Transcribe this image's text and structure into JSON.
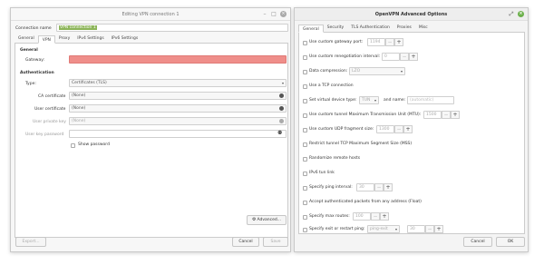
{
  "left": {
    "title": "Editing VPN connection 1",
    "connection_name_label": "Connection name",
    "connection_name_value": "VPN connection 1",
    "tabs": [
      "General",
      "VPN",
      "Proxy",
      "IPv4 Settings",
      "IPv6 Settings"
    ],
    "general_heading": "General",
    "gateway_label": "Gateway:",
    "auth_heading": "Authentication",
    "type_label": "Type:",
    "type_value": "Certificates (TLS)",
    "ca_label": "CA certificate",
    "ca_value": "(None)",
    "user_cert_label": "User certificate",
    "user_cert_value": "(None)",
    "private_key_label": "User private key",
    "private_key_value": "(None)",
    "key_password_label": "User key password",
    "show_password_label": "Show password",
    "advanced_button": "Advanced...",
    "export_button": "Export...",
    "cancel_button": "Cancel",
    "save_button": "Save"
  },
  "right": {
    "title": "OpenVPN Advanced Options",
    "tabs": [
      "General",
      "Security",
      "TLS Authentication",
      "Proxies",
      "Misc"
    ],
    "options": {
      "gateway_port_label": "Use custom gateway port:",
      "gateway_port_value": "1194",
      "reneg_label": "Use custom renegotiation interval:",
      "reneg_value": "0",
      "compression_label": "Data compression:",
      "compression_value": "LZO",
      "tcp_label": "Use a TCP connection",
      "vdev_label": "Set virtual device type:",
      "vdev_value": "TUN",
      "vdev_name_label": "and name:",
      "vdev_name_placeholder": "(automatic)",
      "mtu_label": "Use custom tunnel Maximum Transmission Unit (MTU):",
      "mtu_value": "1500",
      "udp_frag_label": "Use custom UDP fragment size:",
      "udp_frag_value": "1300",
      "mss_label": "Restrict tunnel TCP Maximum Segment Size (MSS)",
      "randomize_label": "Randomize remote hosts",
      "ipv6_label": "IPv6 tun link",
      "ping_label": "Specify ping interval:",
      "ping_value": "30",
      "float_label": "Accept authenticated packets from any address (Float)",
      "max_routes_label": "Specify max routes:",
      "max_routes_value": "100",
      "exit_restart_label": "Specify exit or restart ping:",
      "exit_restart_select": "ping-exit",
      "exit_restart_value": "30"
    },
    "cancel_button": "Cancel",
    "ok_button": "OK"
  },
  "icons": {
    "plus": "+",
    "minus": "−",
    "caret": "▾",
    "restore": "⤢",
    "close": "×"
  }
}
